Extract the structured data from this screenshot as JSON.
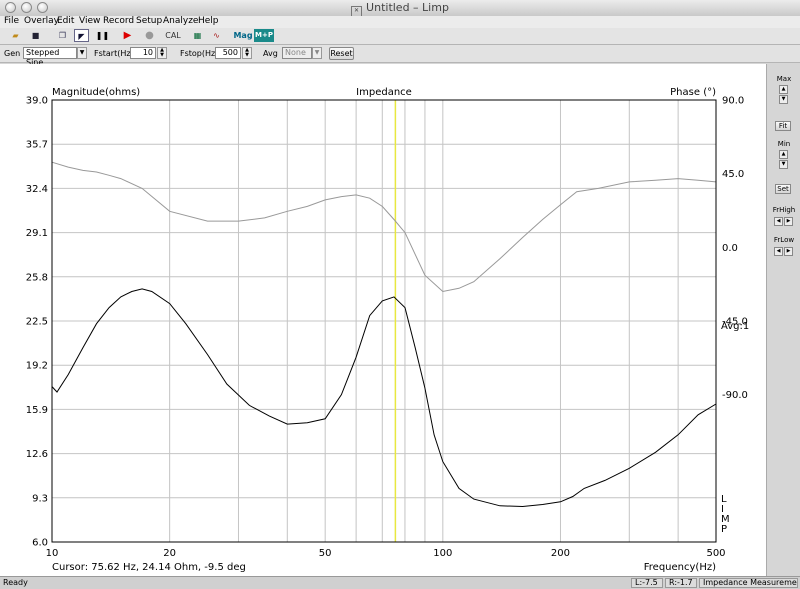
{
  "window": {
    "title": "Untitled – Limp"
  },
  "menu": [
    "File",
    "Overlay",
    "Edit",
    "View",
    "Record",
    "Setup",
    "Analyze",
    "Help"
  ],
  "toolbar": {
    "cal": "CAL",
    "mag": "Mag",
    "mp": "M+P"
  },
  "gen": {
    "gen_label": "Gen",
    "signal": "Stepped Sine",
    "fstart_label": "Fstart(Hz",
    "fstart_value": "10",
    "fstop_label": "Fstop(Hz",
    "fstop_value": "500",
    "avg_label": "Avg",
    "avg_value": "None",
    "reset": "Reset"
  },
  "sidebar": {
    "max": "Max",
    "fit": "Fit",
    "min": "Min",
    "set": "Set",
    "frhigh": "FrHigh",
    "frlow": "FrLow"
  },
  "plot": {
    "left_title": "Magnitude(ohms)",
    "center_title": "Impedance",
    "right_title": "Phase (°)",
    "avg_label": "Avg:1",
    "cursor_text": "Cursor: 75.62 Hz, 24.14 Ohm, -9.5 deg",
    "freq_label": "Frequency(Hz)",
    "limp_letters": [
      "L",
      "I",
      "M",
      "P"
    ],
    "cursor_color": "#e8e840"
  },
  "status": {
    "ready": "Ready",
    "l": "L:-7.5",
    "r": "R:-1.7",
    "mode": "Impedance Measuremen"
  },
  "chart_data": {
    "type": "line",
    "title": "Impedance",
    "xlabel": "Frequency(Hz)",
    "ylabel": "Magnitude(ohms)",
    "y2label": "Phase (°)",
    "xscale": "log",
    "xlim": [
      10,
      500
    ],
    "ylim": [
      6.0,
      39.0
    ],
    "y2lim": [
      -180,
      90
    ],
    "xticks": [
      "10",
      "20",
      "50",
      "100",
      "200",
      "500"
    ],
    "yticks": [
      "39.0",
      "35.7",
      "32.4",
      "29.1",
      "25.8",
      "22.5",
      "19.2",
      "15.9",
      "12.6",
      "9.3",
      "6.0"
    ],
    "y2ticks": [
      "90.0",
      "45.0",
      "0.0",
      "-45.0",
      "-90.0"
    ],
    "cursor_freq": 75.62,
    "series": [
      {
        "name": "Magnitude",
        "axis": "left",
        "color": "#000000",
        "x": [
          10,
          10.3,
          11,
          12,
          13,
          14,
          15,
          16,
          17,
          18,
          20,
          22,
          25,
          28,
          32,
          36,
          40,
          45,
          50,
          55,
          60,
          65,
          70,
          75,
          80,
          85,
          90,
          95,
          100,
          110,
          120,
          140,
          160,
          180,
          200,
          215,
          230,
          260,
          300,
          350,
          400,
          450,
          500
        ],
        "y": [
          17.6,
          17.2,
          18.5,
          20.5,
          22.3,
          23.5,
          24.3,
          24.7,
          24.9,
          24.7,
          23.8,
          22.3,
          20.0,
          17.8,
          16.2,
          15.4,
          14.8,
          14.9,
          15.2,
          17.0,
          19.8,
          22.9,
          24.0,
          24.3,
          23.5,
          20.5,
          17.5,
          14.0,
          12.0,
          10.0,
          9.2,
          8.7,
          8.65,
          8.8,
          9.0,
          9.4,
          10.0,
          10.6,
          11.5,
          12.7,
          14.0,
          15.5,
          16.3
        ]
      },
      {
        "name": "Phase",
        "axis": "right",
        "color": "#999999",
        "x": [
          10,
          11,
          12,
          13,
          14,
          15,
          17,
          20,
          25,
          30,
          35,
          40,
          45,
          50,
          55,
          60,
          65,
          70,
          75,
          80,
          90,
          100,
          110,
          120,
          140,
          160,
          180,
          200,
          220,
          250,
          300,
          350,
          400,
          450,
          500
        ],
        "y": [
          52,
          49,
          47,
          46,
          44,
          42,
          36,
          22,
          16,
          16,
          18,
          22,
          25,
          29,
          31,
          32,
          30,
          25,
          17,
          9,
          -17,
          -27,
          -25,
          -21,
          -7,
          6,
          17,
          26,
          34,
          36,
          40,
          41,
          42,
          41,
          40
        ]
      }
    ]
  }
}
